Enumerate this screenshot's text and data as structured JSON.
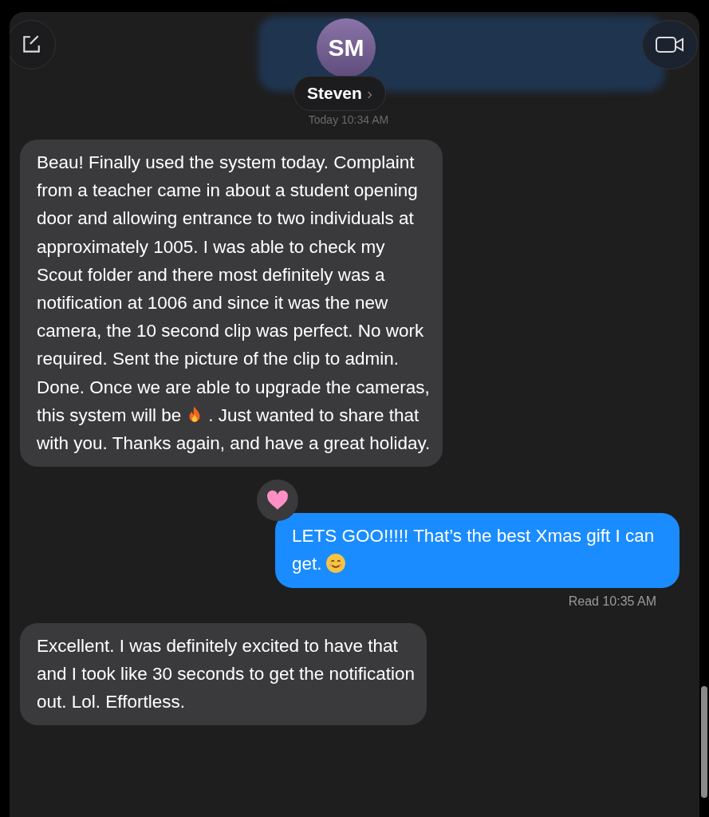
{
  "contact": {
    "initials": "SM",
    "name": "Steven",
    "chevron": "›"
  },
  "timestamp": "Today 10:34 AM",
  "messages": [
    {
      "kind": "received",
      "parts": [
        {
          "kind": "text",
          "text": "Beau! Finally used the system today. Complaint from a teacher came in about a student opening door and allowing entrance to two individuals at approximately 1005. I was able to check my Scout folder and there most definitely was a notification at 1006 and since it was the new camera, the 10 second clip was perfect. No work required. Sent the picture of the clip to admin. Done. Once we are able to upgrade the cameras, this system will be"
        },
        {
          "kind": "fire"
        },
        {
          "kind": "text",
          "text": ". Just wanted to share that with you. Thanks again, and have a great holiday."
        }
      ]
    },
    {
      "kind": "sent",
      "parts": [
        {
          "kind": "text",
          "text": "LETS GOO!!!!! That’s the best Xmas gift I can get."
        },
        {
          "kind": "smile"
        }
      ],
      "tapback": true,
      "status": "Read 10:35 AM"
    },
    {
      "kind": "received",
      "parts": [
        {
          "kind": "text",
          "text": "Excellent. I was definitely excited to have that and I took like 30 seconds to get the notification out. Lol. Effortless."
        }
      ]
    }
  ]
}
